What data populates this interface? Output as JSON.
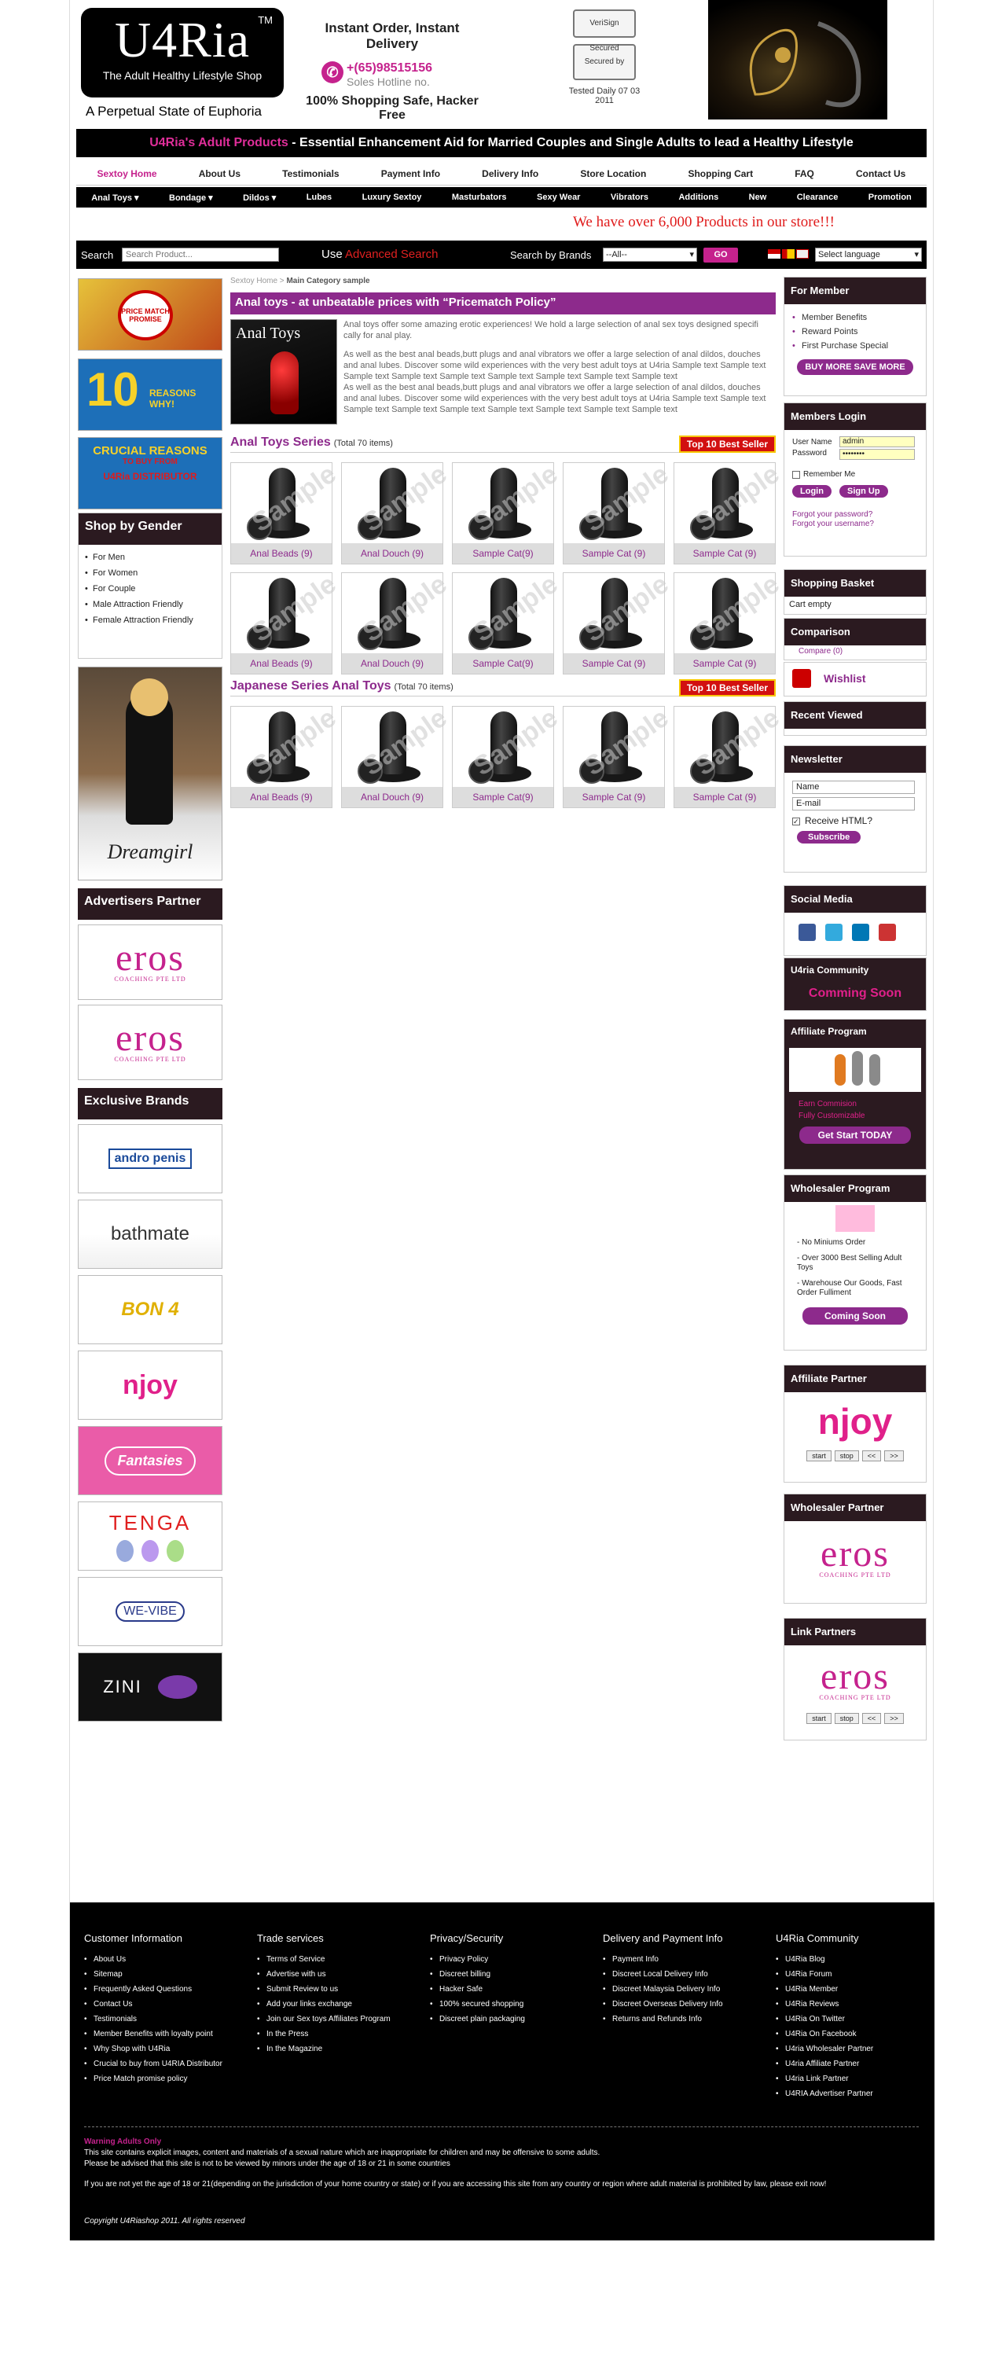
{
  "header": {
    "logo_main": "U4Ria",
    "logo_tm": "TM",
    "logo_sub": "The Adult Healthy Lifestyle Shop",
    "tagline": "A Perpetual State of Euphoria",
    "instant": "Instant Order, Instant Delivery",
    "phone": "+(65)98515156",
    "hotline": "Soles Hotline no.",
    "safe": "100% Shopping Safe, Hacker Free",
    "badge1": "VeriSign Secured",
    "badge2": "Secured by",
    "tested": "Tested Daily 07 03 2011"
  },
  "banner": {
    "pink": "U4Ria's Adult Products",
    "rest": " - Essential Enhancement Aid for Married Couples and Single Adults to lead a Healthy Lifestyle"
  },
  "main_nav": [
    "Sextoy Home",
    "About Us",
    "Testimonials",
    "Payment Info",
    "Delivery Info",
    "Store Location",
    "Shopping Cart",
    "FAQ",
    "Contact Us"
  ],
  "cat_nav": [
    "Anal Toys ▾",
    "Bondage ▾",
    "Dildos ▾",
    "Lubes",
    "Luxury Sextoy",
    "Masturbators",
    "Sexy Wear",
    "Vibrators",
    "Additions",
    "New",
    "Clearance",
    "Promotion"
  ],
  "promo_text": "We have over 6,000 Products in our store!!!",
  "search": {
    "label": "Search",
    "placeholder": "Search Product...",
    "use": "Use ",
    "advanced": "Advanced Search",
    "brands_label": "Search by Brands",
    "brands_value": "--All--",
    "go": "GO",
    "language": "Select language"
  },
  "left": {
    "banner1": "PRICE MATCH PROMISE",
    "banner2_num": "10",
    "banner2_text": "REASONS WHY!",
    "banner3_a": "CRUCIAL REASONS",
    "banner3_b": "TO BUY FROM",
    "banner3_c": "U4Ria DISTRIBUTOR",
    "gender_title": "Shop by Gender",
    "gender_items": [
      "For Men",
      "For Women",
      "For Couple",
      "Male Attraction Friendly",
      "Female Attraction Friendly"
    ],
    "dreamgirl": "Dreamgirl",
    "adv_title": "Advertisers Partner",
    "eros": "eros",
    "eros_sub": "COACHING PTE LTD",
    "excl_title": "Exclusive Brands",
    "brands": [
      "andro penis",
      "bathmate",
      "BON 4",
      "njoy",
      "Fantasies",
      "TENGA",
      "WE-VIBE",
      "ZINI"
    ]
  },
  "content": {
    "breadcrumb_a": "Sextoy Home",
    "breadcrumb_sep": " > ",
    "breadcrumb_b": "Main Category sample",
    "title": "Anal toys - at unbeatable prices with “Pricematch Policy”",
    "cat_image_label": "Anal Toys",
    "desc1": "Anal toys offer some amazing erotic experiences! We hold a large selection of anal sex toys designed specifi cally for anal play.",
    "desc2": "As well as the best anal beads,butt plugs and anal vibrators we offer a large selection of anal dildos, douches and anal lubes. Discover some wild experiences with the very best adult toys at U4ria Sample text Sample text Sample text Sample text Sample text Sample text Sample text Sample text Sample text",
    "desc3": "As well as the best anal beads,butt plugs and anal vibrators we offer a large selection of anal dildos, douches and anal lubes. Discover some wild experiences with the very best adult toys at U4ria Sample text Sample text Sample text Sample text Sample text Sample text Sample text Sample text Sample text",
    "section1_title": "Anal Toys Series",
    "section1_count": "(Total 70 items)",
    "section2_title": "Japanese Series Anal Toys",
    "section2_count": "(Total 70 items)",
    "top10": "Top 10 Best Seller",
    "watermark": "Sample",
    "products_row": [
      "Anal Beads (9)",
      "Anal Douch (9)",
      "Sample Cat(9)",
      "Sample Cat (9)",
      "Sample Cat (9)"
    ]
  },
  "right": {
    "member_title": "For Member",
    "member_items": [
      "Member Benefits",
      "Reward Points",
      "First Purchase Special"
    ],
    "buy_more": "BUY MORE SAVE MORE",
    "login_title": "Members Login",
    "user_label": "User Name",
    "user_value": "admin",
    "pass_label": "Password",
    "pass_value": "••••••••",
    "remember": "Remember Me",
    "login_btn": "Login",
    "signup_btn": "Sign Up",
    "forgot_pw": "Forgot your password?",
    "forgot_user": "Forgot your username?",
    "basket_title": "Shopping Basket",
    "basket_text": "Cart empty",
    "comparison_title": "Comparison",
    "compare_text": "Compare (0)",
    "wishlist": "Wishlist",
    "recent_title": "Recent Viewed",
    "newsletter_title": "Newsletter",
    "name_placeholder": "Name",
    "email_placeholder": "E-mail",
    "receive_html": "Receive HTML?",
    "subscribe": "Subscribe",
    "social_title": "Social Media",
    "community_title": "U4ria Community",
    "coming_soon": "Comming Soon",
    "affiliate_title": "Affiliate Program",
    "earn": "Earn Commision",
    "customizable": "Fully Customizable",
    "get_start": "Get Start TODAY",
    "wholesaler_title": "Wholesaler Program",
    "wholesaler_items": [
      "- No Miniums Order",
      "- Over 3000 Best Selling Adult Toys",
      "- Warehouse Our Goods, Fast Order Fulliment"
    ],
    "coming_soon_btn": "Coming Soon",
    "aff_partner_title": "Affiliate Partner",
    "njoy": "njoy",
    "ctrl": [
      "start",
      "stop",
      "<<",
      ">>"
    ],
    "ws_partner_title": "Wholesaler Partner",
    "link_partner_title": "Link Partners"
  },
  "footer": {
    "cols": [
      {
        "title": "Customer Information",
        "items": [
          "About Us",
          "Sitemap",
          "Frequently Asked Questions",
          "Contact Us",
          "Testimonials",
          "Member Benefits with loyalty point",
          "Why Shop with U4Ria",
          "Crucial to buy from U4RIA Distributor",
          "Price Match promise policy"
        ]
      },
      {
        "title": "Trade services",
        "items": [
          "Terms of Service",
          "Advertise with us",
          "Submit Review to us",
          "Add your links exchange",
          "Join our Sex toys Affiliates Program",
          "In the Press",
          "In the Magazine"
        ]
      },
      {
        "title": "Privacy/Security",
        "items": [
          "Privacy Policy",
          "Discreet billing",
          "Hacker Safe",
          "100% secured shopping",
          "Discreet plain packaging"
        ]
      },
      {
        "title": "Delivery and Payment Info",
        "items": [
          "Payment Info",
          "Discreet Local Delivery Info",
          "Discreet Malaysia Delivery Info",
          "Discreet Overseas Delivery Info",
          "Returns and Refunds Info"
        ]
      },
      {
        "title": "U4Ria Community",
        "items": [
          "U4Ria Blog",
          "U4Ria Forum",
          "U4Ria Member",
          "U4Ria Reviews",
          "U4Ria On Twitter",
          "U4Ria On Facebook",
          "U4ria Wholesaler Partner",
          "U4ria Affiliate Partner",
          "U4ria Link Partner",
          "U4RIA Advertiser Partner"
        ]
      }
    ],
    "warn_title": "Warning Adults Only",
    "warn1": "This site contains explicit images, content and materials of a sexual nature which are inappropriate for children and may be offensive to some adults.",
    "warn2": "Please be advised that this site is not to be viewed by minors under the age of 18 or 21 in some countries",
    "warn3": "If you are not yet the age of 18 or 21(depending on the jurisdiction of your home country or state) or if you are accessing this site from any country or region where adult material is prohibited by law, please exit now!",
    "copyright": "Copyright U4Riashop 2011. All rights reserved"
  }
}
